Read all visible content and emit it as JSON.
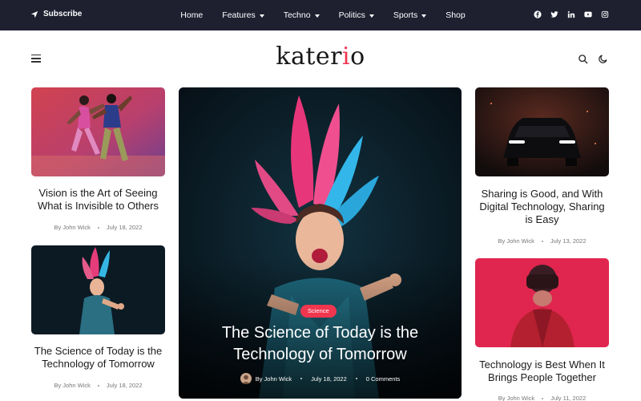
{
  "topbar": {
    "subscribe_label": "Subscribe",
    "nav": [
      {
        "label": "Home",
        "has_dropdown": false
      },
      {
        "label": "Features",
        "has_dropdown": true
      },
      {
        "label": "Techno",
        "has_dropdown": true
      },
      {
        "label": "Politics",
        "has_dropdown": true
      },
      {
        "label": "Sports",
        "has_dropdown": true
      },
      {
        "label": "Shop",
        "has_dropdown": false
      }
    ],
    "socials": [
      "facebook-icon",
      "twitter-icon",
      "linkedin-icon",
      "youtube-icon",
      "instagram-icon"
    ]
  },
  "header": {
    "logo": "katerio",
    "icons": [
      "hamburger-icon",
      "search-icon",
      "moon-icon"
    ]
  },
  "colors": {
    "topbar_bg": "#1e2030",
    "accent": "#f0364f",
    "text": "#1b1b1b"
  },
  "posts": {
    "left_top": {
      "title": "Vision is the Art of Seeing What is Invisible to Others",
      "author": "By John Wick",
      "date": "July 18, 2022"
    },
    "left_bottom": {
      "title": "The Science of Today is the Technology of Tomorrow",
      "author": "By John Wick",
      "date": "July 18, 2022"
    },
    "right_top": {
      "title": "Sharing is Good, and With Digital Technology, Sharing is Easy",
      "author": "By John Wick",
      "date": "July 13, 2022"
    },
    "right_bottom": {
      "title": "Technology is Best When It Brings People Together",
      "author": "By John Wick",
      "date": "July 11, 2022"
    }
  },
  "feature": {
    "category": "Science",
    "title": "The Science of Today is the Technology of Tomorrow",
    "author": "By John Wick",
    "date": "July 18, 2022",
    "comments": "0 Comments"
  }
}
